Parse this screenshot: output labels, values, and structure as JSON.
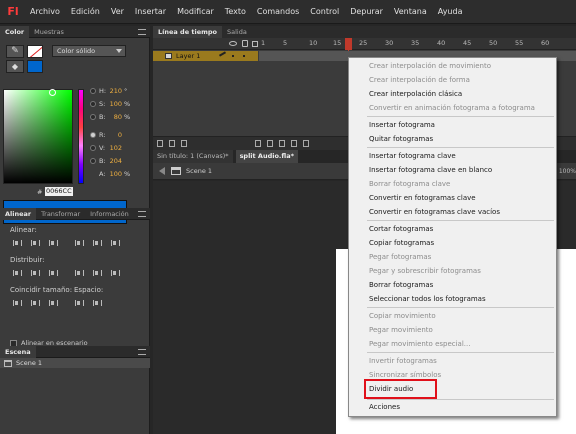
{
  "menubar": {
    "logo": "Fl",
    "items": [
      "Archivo",
      "Edición",
      "Ver",
      "Insertar",
      "Modificar",
      "Texto",
      "Comandos",
      "Control",
      "Depurar",
      "Ventana",
      "Ayuda"
    ]
  },
  "color_panel": {
    "tabs": [
      "Color",
      "Muestras"
    ],
    "color_type": "Color sólido",
    "hsv": [
      {
        "label": "H:",
        "value": "210",
        "unit": "°"
      },
      {
        "label": "S:",
        "value": "100",
        "unit": "%"
      },
      {
        "label": "B:",
        "value": "80",
        "unit": "%"
      }
    ],
    "rgb": [
      {
        "label": "R:",
        "value": "0"
      },
      {
        "label": "V:",
        "value": "102"
      },
      {
        "label": "B:",
        "value": "204"
      }
    ],
    "alpha": {
      "label": "A:",
      "value": "100",
      "unit": "%"
    },
    "hex_label": "#",
    "hex_value": "0066CC",
    "fill_color": "#0066cc"
  },
  "align_panel": {
    "tabs": [
      "Alinear",
      "Transformar",
      "Información"
    ],
    "align_label": "Alinear:",
    "distribute_label": "Distribuir:",
    "match_size_label": "Coincidir tamaño:",
    "space_label": "Espacio:",
    "stage_checkbox_label": "Alinear en escenario"
  },
  "scene_panel": {
    "tab": "Escena",
    "scene_item": "Scene 1"
  },
  "timeline": {
    "tabs": [
      "Línea de tiempo",
      "Salida"
    ],
    "frame_numbers": [
      "1",
      "5",
      "10",
      "15",
      "20",
      "25",
      "30",
      "35",
      "40",
      "45",
      "50",
      "55",
      "60"
    ],
    "current_frame": "20",
    "layer_name": "Layer 1",
    "accent": "#c0392b"
  },
  "documents": {
    "tabs": [
      "Sin título: 1 (Canvas)*",
      "split Audio.fla*"
    ],
    "scene_crumb": "Scene 1",
    "zoom": "100%"
  },
  "context_menu": {
    "items": [
      {
        "label": "Crear interpolación de movimiento",
        "enabled": false
      },
      {
        "label": "Crear interpolación de forma",
        "enabled": false
      },
      {
        "label": "Crear interpolación clásica",
        "enabled": true
      },
      {
        "label": "Convertir en animación fotograma a fotograma",
        "enabled": false
      },
      {
        "label": "Insertar fotograma",
        "enabled": true
      },
      {
        "label": "Quitar fotogramas",
        "enabled": true
      },
      {
        "label": "Insertar fotograma clave",
        "enabled": true
      },
      {
        "label": "Insertar fotograma clave en blanco",
        "enabled": true
      },
      {
        "label": "Borrar fotograma clave",
        "enabled": false
      },
      {
        "label": "Convertir en fotogramas clave",
        "enabled": true
      },
      {
        "label": "Convertir en fotogramas clave vacíos",
        "enabled": true
      },
      {
        "label": "Cortar fotogramas",
        "enabled": true
      },
      {
        "label": "Copiar fotogramas",
        "enabled": true
      },
      {
        "label": "Pegar fotogramas",
        "enabled": false
      },
      {
        "label": "Pegar y sobrescribir fotogramas",
        "enabled": false
      },
      {
        "label": "Borrar fotogramas",
        "enabled": true
      },
      {
        "label": "Seleccionar todos los fotogramas",
        "enabled": true
      },
      {
        "label": "Copiar movimiento",
        "enabled": false
      },
      {
        "label": "Pegar movimiento",
        "enabled": false
      },
      {
        "label": "Pegar movimiento especial...",
        "enabled": false
      },
      {
        "label": "Invertir fotogramas",
        "enabled": false
      },
      {
        "label": "Sincronizar símbolos",
        "enabled": false
      },
      {
        "label": "Dividir audio",
        "enabled": true
      },
      {
        "label": "Acciones",
        "enabled": true
      }
    ],
    "highlight_color": "#e0101a"
  }
}
